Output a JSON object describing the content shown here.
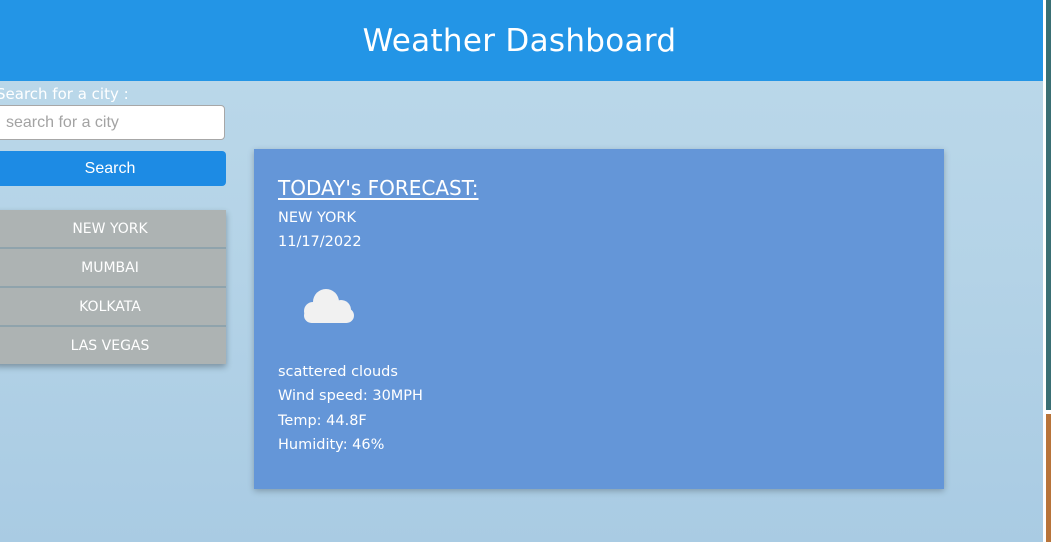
{
  "header": {
    "title": "Weather Dashboard"
  },
  "search": {
    "label": "Search for a city :",
    "placeholder": "search for a city",
    "value": "",
    "button_label": "Search"
  },
  "history": {
    "cities": [
      "NEW YORK",
      "MUMBAI",
      "KOLKATA",
      "LAS VEGAS"
    ]
  },
  "forecast": {
    "heading": "TODAY's FORECAST:",
    "city": "NEW YORK",
    "date": "11/17/2022",
    "icon": "cloud-icon",
    "description": "scattered clouds",
    "wind": "Wind speed: 30MPH",
    "temp": "Temp: 44.8F",
    "humidity": "Humidity: 46%"
  },
  "colors": {
    "header_bg": "#2395e6",
    "card_bg": "#6496d8",
    "button_bg": "#1d8be4",
    "city_item_bg": "#adb3b3"
  }
}
